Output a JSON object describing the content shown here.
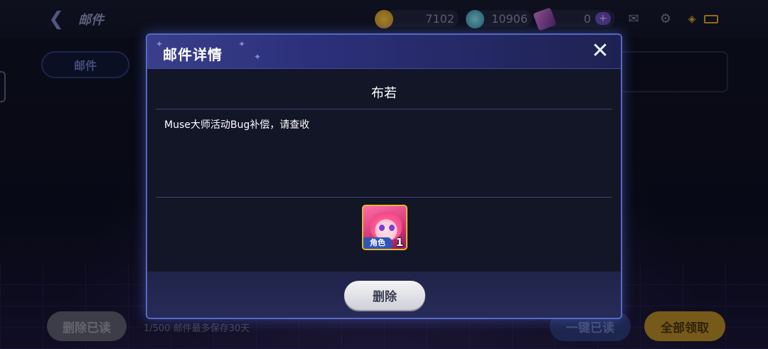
{
  "topbar": {
    "title": "邮件",
    "resources": [
      {
        "icon": "music-coin-icon",
        "value": "7102",
        "color": "#e0a52a"
      },
      {
        "icon": "diamond-icon",
        "value": "10906",
        "color": "#3fb7c9"
      },
      {
        "icon": "ticket-icon",
        "value": "0",
        "color": "#b05ac8"
      }
    ]
  },
  "sidebar": {
    "tab_label": "邮件"
  },
  "bottom": {
    "delete_read_label": "删除已读",
    "note": "1/500 邮件最多保存30天",
    "read_all_label": "一键已读",
    "claim_all_label": "全部领取"
  },
  "dialog": {
    "title": "邮件详情",
    "sender": "布若",
    "message": "Muse大师活动Bug补偿，请查收",
    "reward": {
      "label": "角色",
      "count": "1"
    },
    "delete_label": "删除"
  },
  "colors": {
    "accent": "#5468c6",
    "gold": "#e8b531"
  }
}
